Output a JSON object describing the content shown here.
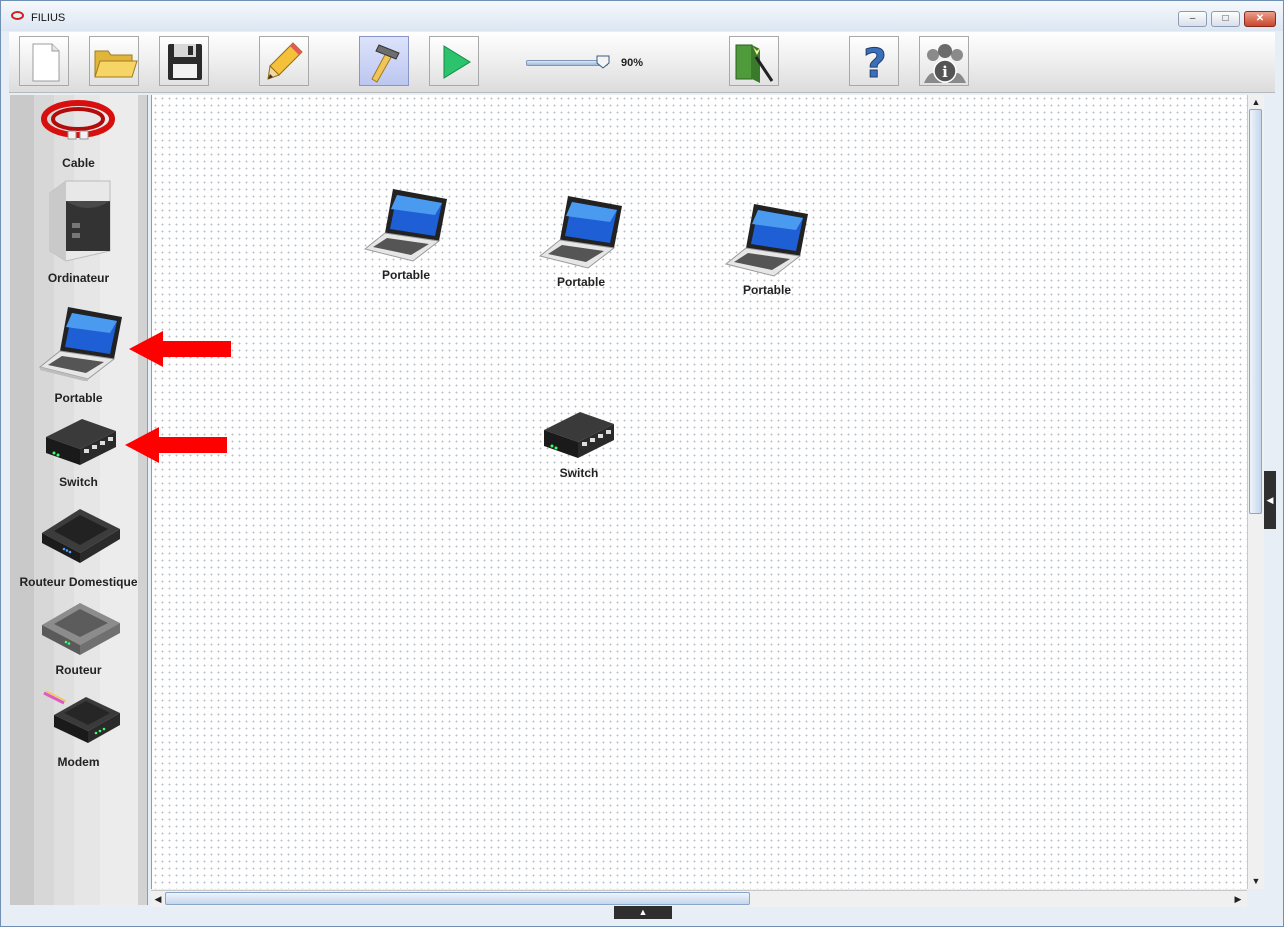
{
  "window": {
    "title": "FILIUS",
    "minimize": "–",
    "maximize": "□",
    "close": "✕"
  },
  "toolbar": {
    "buttons": [
      {
        "icon": "new-file-icon"
      },
      {
        "icon": "open-folder-icon"
      },
      {
        "icon": "save-icon"
      },
      {
        "icon": "design-pencil-icon"
      },
      {
        "icon": "hammer-icon",
        "active": true
      },
      {
        "icon": "play-icon"
      },
      {
        "icon": "wizard-icon"
      },
      {
        "icon": "help-icon"
      },
      {
        "icon": "info-icon"
      }
    ],
    "zoom_label": "90%",
    "zoom_level": 0.9
  },
  "palette": {
    "items": [
      {
        "label": "Cable",
        "icon": "cable-icon"
      },
      {
        "label": "Ordinateur",
        "icon": "computer-icon"
      },
      {
        "label": "Portable",
        "icon": "laptop-icon"
      },
      {
        "label": "Switch",
        "icon": "switch-icon"
      },
      {
        "label": "Routeur Domestique",
        "icon": "home-router-icon"
      },
      {
        "label": "Routeur",
        "icon": "router-icon"
      },
      {
        "label": "Modem",
        "icon": "modem-icon"
      }
    ]
  },
  "canvas": {
    "nodes": [
      {
        "label": "Portable",
        "type": "laptop"
      },
      {
        "label": "Portable",
        "type": "laptop"
      },
      {
        "label": "Portable",
        "type": "laptop"
      },
      {
        "label": "Switch",
        "type": "switch"
      }
    ]
  },
  "annotations": {
    "arrow_color": "#ff0000"
  }
}
